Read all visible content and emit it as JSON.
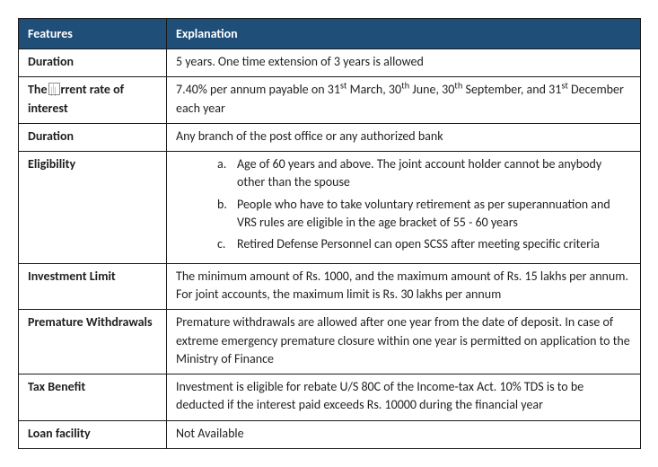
{
  "header": {
    "features": "Features",
    "explanation": "Explanation"
  },
  "rows": {
    "duration1": {
      "feature": "Duration",
      "value": "5 years. One time extension of 3 years is allowed"
    },
    "rate": {
      "feature_prefix": "The",
      "feature_suffix": "rrent rate of interest",
      "prefix": "7.40% per annum payable on 31",
      "sup1": "st",
      "mid1": " March, 30",
      "sup2": "th",
      "mid2": " June, 30",
      "sup3": "th",
      "mid3": " September, and 31",
      "sup4": "st",
      "suffix": " December each year"
    },
    "duration2": {
      "feature": "Duration",
      "value": "Any branch of the post office or any authorized bank"
    },
    "eligibility": {
      "feature": "Eligibility",
      "items": [
        "Age of 60 years and above. The joint account holder cannot be anybody other than the spouse",
        "People who have to take voluntary retirement as per superannuation and VRS rules are eligible in the age bracket of 55 - 60 years",
        "Retired Defense Personnel can open SCSS after meeting specific criteria"
      ]
    },
    "investment": {
      "feature": "Investment Limit",
      "value": "The minimum amount of Rs. 1000, and the maximum amount of Rs. 15 lakhs per annum. For joint accounts, the maximum limit is Rs. 30 lakhs per annum"
    },
    "premature": {
      "feature": "Premature Withdrawals",
      "value": "Premature withdrawals are allowed after one year from the date of deposit. In case of extreme emergency premature closure within one year is permitted on application to the Ministry of Finance"
    },
    "tax": {
      "feature": "Tax Benefit",
      "value": "Investment is eligible for rebate U/S 80C of the Income-tax Act. 10% TDS is to be deducted if the interest paid exceeds Rs. 10000 during the financial year"
    },
    "loan": {
      "feature": "Loan facility",
      "value": "Not Available"
    }
  }
}
